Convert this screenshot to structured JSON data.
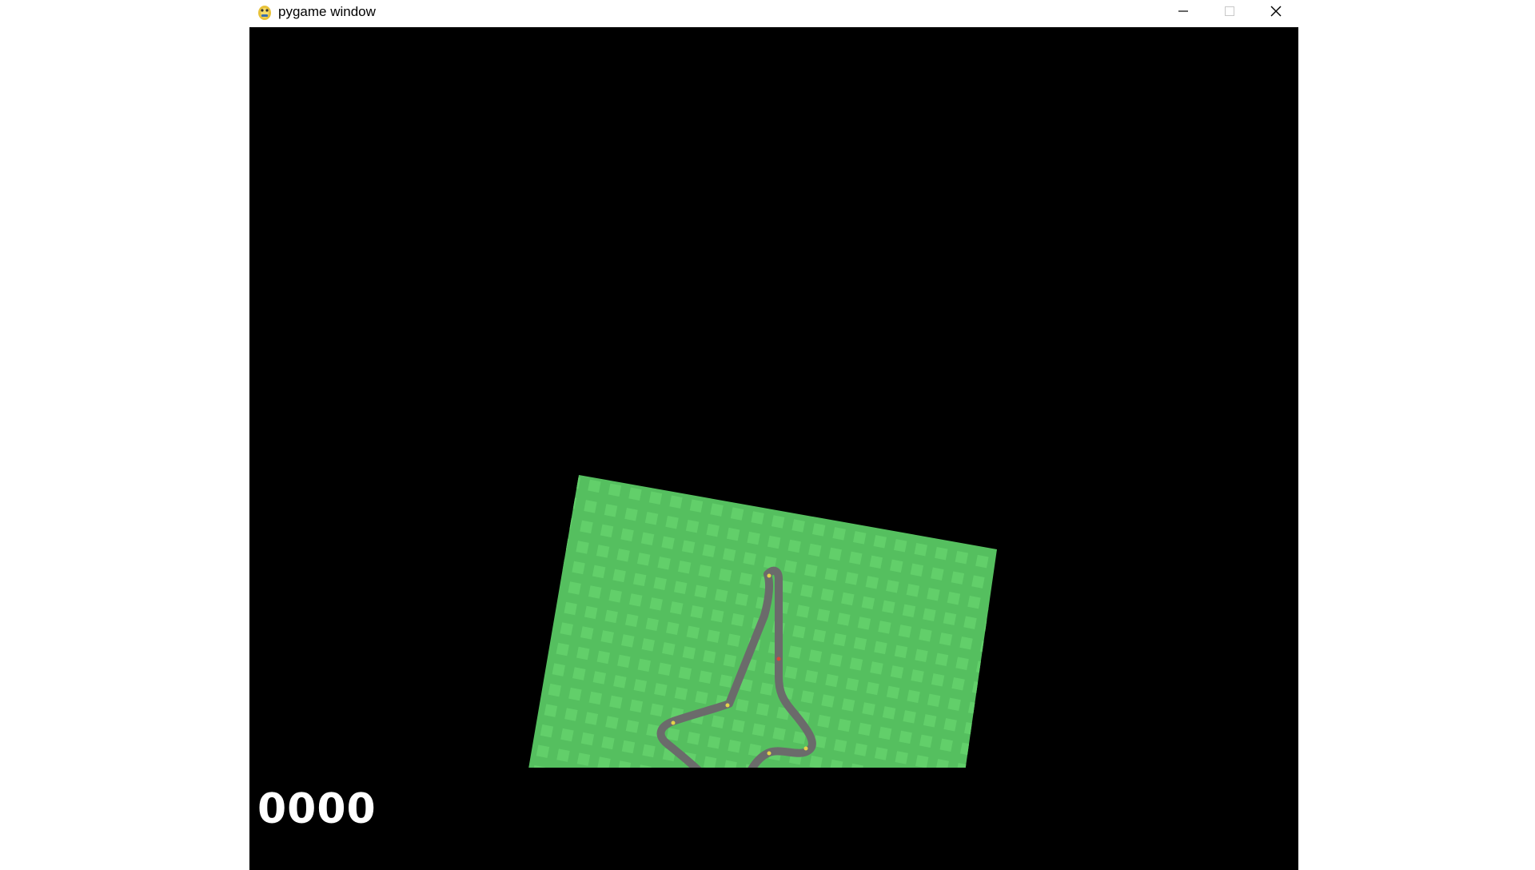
{
  "window": {
    "title": "pygame window",
    "icon": "pygame-snake-icon",
    "controls": [
      "minimize-icon",
      "maximize-icon",
      "close-icon"
    ]
  },
  "game": {
    "score": "0000",
    "colors": {
      "background": "#000000",
      "grass": "#55bf5f",
      "grass_tile": "#62cf6a",
      "track": "#6b6b6b",
      "hud_text": "#ffffff"
    }
  }
}
